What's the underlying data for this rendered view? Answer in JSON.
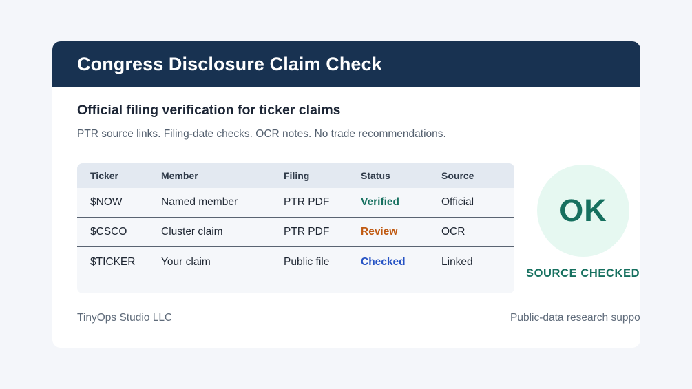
{
  "header": {
    "title": "Congress Disclosure Claim Check"
  },
  "intro": {
    "subtitle": "Official filing verification for ticker claims",
    "description": "PTR source links. Filing-date checks. OCR notes. No trade recommendations."
  },
  "table": {
    "columns": [
      "Ticker",
      "Member",
      "Filing",
      "Status",
      "Source"
    ],
    "rows": [
      {
        "ticker": "$NOW",
        "member": "Named member",
        "filing": "PTR PDF",
        "status": "Verified",
        "source": "Official"
      },
      {
        "ticker": "$CSCO",
        "member": "Cluster claim",
        "filing": "PTR PDF",
        "status": "Review",
        "source": "OCR"
      },
      {
        "ticker": "$TICKER",
        "member": "Your claim",
        "filing": "Public file",
        "status": "Checked",
        "source": "Linked"
      }
    ]
  },
  "status_colors": {
    "Verified": "#16705f",
    "Review": "#c05a12",
    "Checked": "#2653c4"
  },
  "badge": {
    "text": "OK",
    "caption": "SOURCE CHECKED"
  },
  "footer": {
    "left": "TinyOps Studio LLC",
    "right": "Public-data research support"
  },
  "colors": {
    "header_bg": "#183251",
    "accent": "#16705f",
    "badge_bg": "#e6f8f1"
  }
}
